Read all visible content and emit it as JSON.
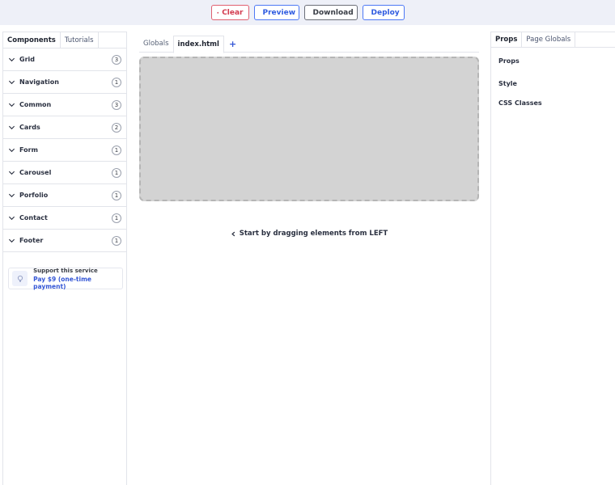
{
  "toolbar": {
    "clear_label": "Clear",
    "preview_label": "Preview",
    "download_label": "Download",
    "deploy_label": "Deploy"
  },
  "left_panel": {
    "tabs": [
      {
        "label": "Components",
        "active": true
      },
      {
        "label": "Tutorials",
        "active": false
      }
    ],
    "categories": [
      {
        "label": "Grid",
        "count": "3"
      },
      {
        "label": "Navigation",
        "count": "1"
      },
      {
        "label": "Common",
        "count": "3"
      },
      {
        "label": "Cards",
        "count": "2"
      },
      {
        "label": "Form",
        "count": "1"
      },
      {
        "label": "Carousel",
        "count": "1"
      },
      {
        "label": "Porfolio",
        "count": "1"
      },
      {
        "label": "Contact",
        "count": "1"
      },
      {
        "label": "Footer",
        "count": "1"
      }
    ],
    "support": {
      "title": "Support this service",
      "link": "Pay $9 (one-time payment)"
    }
  },
  "center": {
    "tabs": [
      {
        "label": "Globals",
        "active": false
      },
      {
        "label": "index.html",
        "active": true
      }
    ],
    "add_tab_label": "+",
    "hint": "Start by dragging elements from LEFT"
  },
  "right_panel": {
    "tabs": [
      {
        "label": "Props",
        "active": true
      },
      {
        "label": "Page Globals",
        "active": false
      }
    ],
    "sections": [
      "Props",
      "Style",
      "CSS Classes"
    ]
  },
  "colors": {
    "toolbar_bg": "#eef0f8",
    "clear": "#d23a4e",
    "primary": "#2f5be0",
    "neutral": "#3a3e46",
    "dropzone": "#d3d3d3"
  }
}
